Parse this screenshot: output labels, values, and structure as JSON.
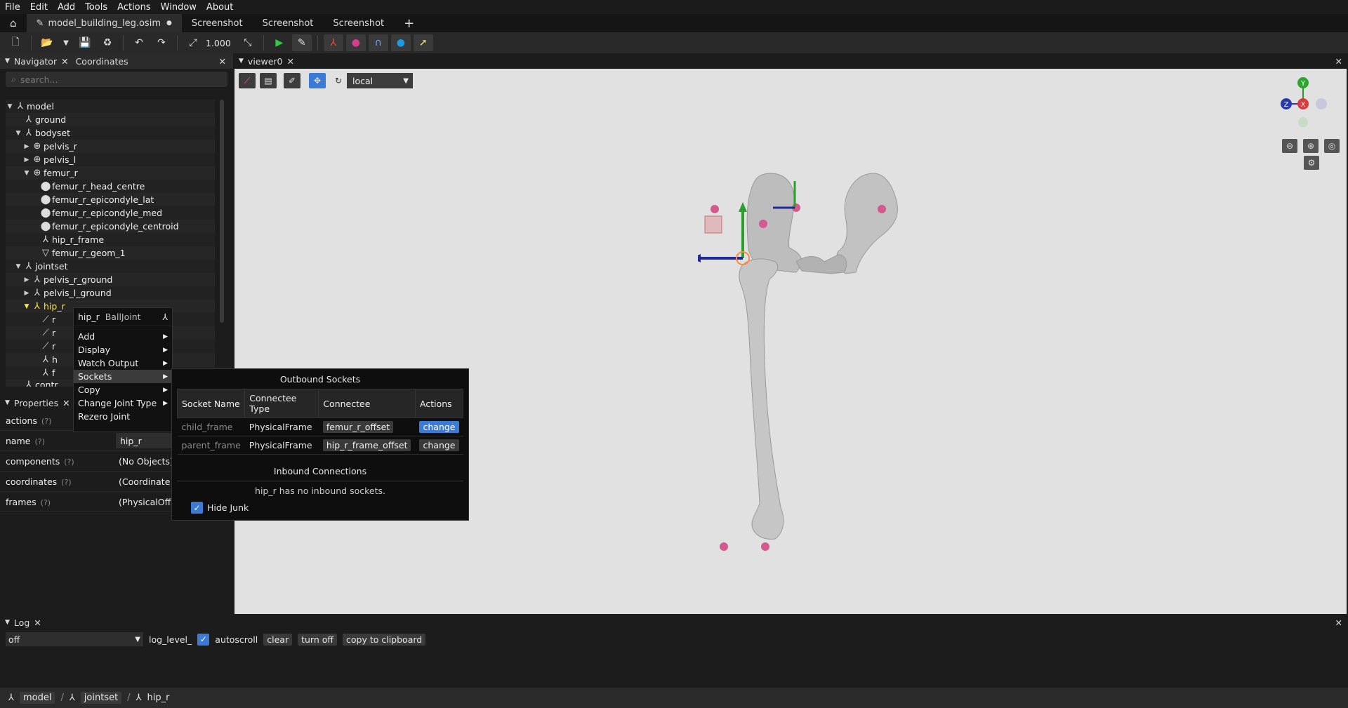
{
  "menu": [
    "File",
    "Edit",
    "Add",
    "Tools",
    "Actions",
    "Window",
    "About"
  ],
  "tabs": {
    "file": "model_building_leg.osim",
    "dot": "●",
    "s1": "Screenshot",
    "s2": "Screenshot",
    "s3": "Screenshot",
    "plus": "+"
  },
  "toolbar": {
    "scale": "1.000"
  },
  "navigator": {
    "title": "Navigator",
    "tab2": "Coordinates",
    "search_placeholder": "search..."
  },
  "tree": [
    {
      "label": "model"
    },
    {
      "label": "ground"
    },
    {
      "label": "bodyset"
    },
    {
      "label": "pelvis_r"
    },
    {
      "label": "pelvis_l"
    },
    {
      "label": "femur_r"
    },
    {
      "label": "femur_r_head_centre"
    },
    {
      "label": "femur_r_epicondyle_lat"
    },
    {
      "label": "femur_r_epicondyle_med"
    },
    {
      "label": "femur_r_epicondyle_centroid"
    },
    {
      "label": "hip_r_frame"
    },
    {
      "label": "femur_r_geom_1"
    },
    {
      "label": "jointset"
    },
    {
      "label": "pelvis_r_ground"
    },
    {
      "label": "pelvis_l_ground"
    },
    {
      "label": "hip_r"
    },
    {
      "label": "r"
    },
    {
      "label": "r"
    },
    {
      "label": "r"
    },
    {
      "label": "h"
    },
    {
      "label": "f"
    },
    {
      "label": "contr"
    }
  ],
  "properties": {
    "title": "Properties",
    "rows": [
      {
        "key": "actions",
        "value": ""
      },
      {
        "key": "name",
        "value": "hip_r"
      },
      {
        "key": "components",
        "value": "(No Objects)"
      },
      {
        "key": "coordinates",
        "value": "(Coordinate"
      },
      {
        "key": "frames",
        "value": "(PhysicalOffs"
      }
    ],
    "help": "(?)"
  },
  "viewer": {
    "title": "viewer0",
    "frame_mode": "local"
  },
  "context_menu": {
    "header": "hip_r",
    "type": "BallJoint",
    "items": [
      "Add",
      "Display",
      "Watch Output",
      "Sockets",
      "Copy",
      "Change Joint Type",
      "Rezero Joint"
    ]
  },
  "sockets": {
    "outbound_title": "Outbound Sockets",
    "headers": [
      "Socket Name",
      "Connectee Type",
      "Connectee",
      "Actions"
    ],
    "rows": [
      {
        "name": "child_frame",
        "type": "PhysicalFrame",
        "connectee": "femur_r_offset",
        "action": "change"
      },
      {
        "name": "parent_frame",
        "type": "PhysicalFrame",
        "connectee": "hip_r_frame_offset",
        "action": "change"
      }
    ],
    "inbound_title": "Inbound Connections",
    "inbound_text": "hip_r has no inbound sockets.",
    "hide_junk": "Hide Junk"
  },
  "log": {
    "title": "Log",
    "level": "off",
    "level_label": "log_level_",
    "autoscroll": "autoscroll",
    "clear": "clear",
    "turn_off": "turn off",
    "copy": "copy to clipboard"
  },
  "breadcrumb": [
    "model",
    "jointset",
    "hip_r"
  ],
  "axes": {
    "y": "Y",
    "x": "X",
    "z": "Z"
  }
}
